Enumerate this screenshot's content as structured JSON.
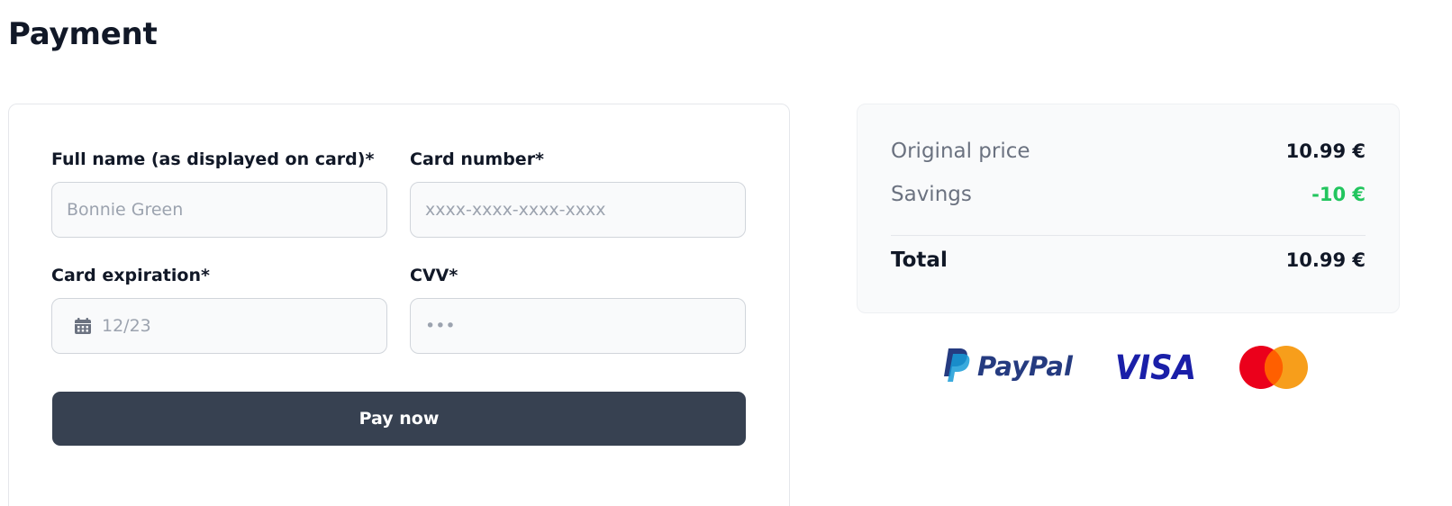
{
  "page": {
    "title": "Payment"
  },
  "form": {
    "full_name": {
      "label": "Full name (as displayed on card)*",
      "placeholder": "Bonnie Green",
      "value": ""
    },
    "card_number": {
      "label": "Card number*",
      "placeholder": "xxxx-xxxx-xxxx-xxxx",
      "value": ""
    },
    "card_expiration": {
      "label": "Card expiration*",
      "placeholder": "12/23",
      "value": "",
      "icon": "calendar-icon"
    },
    "cvv": {
      "label": "CVV*",
      "placeholder": "•••",
      "value": ""
    },
    "pay_button": "Pay now"
  },
  "summary": {
    "original_price_label": "Original price",
    "original_price_value": "10.99 €",
    "savings_label": "Savings",
    "savings_value": "-10 €",
    "total_label": "Total",
    "total_value": "10.99 €"
  },
  "logos": {
    "paypal": "PayPal",
    "visa": "VISA",
    "mastercard": "mastercard-logo"
  },
  "colors": {
    "button_bg": "#374151",
    "savings_green": "#22c55e",
    "paypal_dark": "#253b80",
    "paypal_light": "#179bd7",
    "visa_blue": "#1a1fa8",
    "mastercard_red": "#eb001b",
    "mastercard_orange": "#f79e1b"
  }
}
